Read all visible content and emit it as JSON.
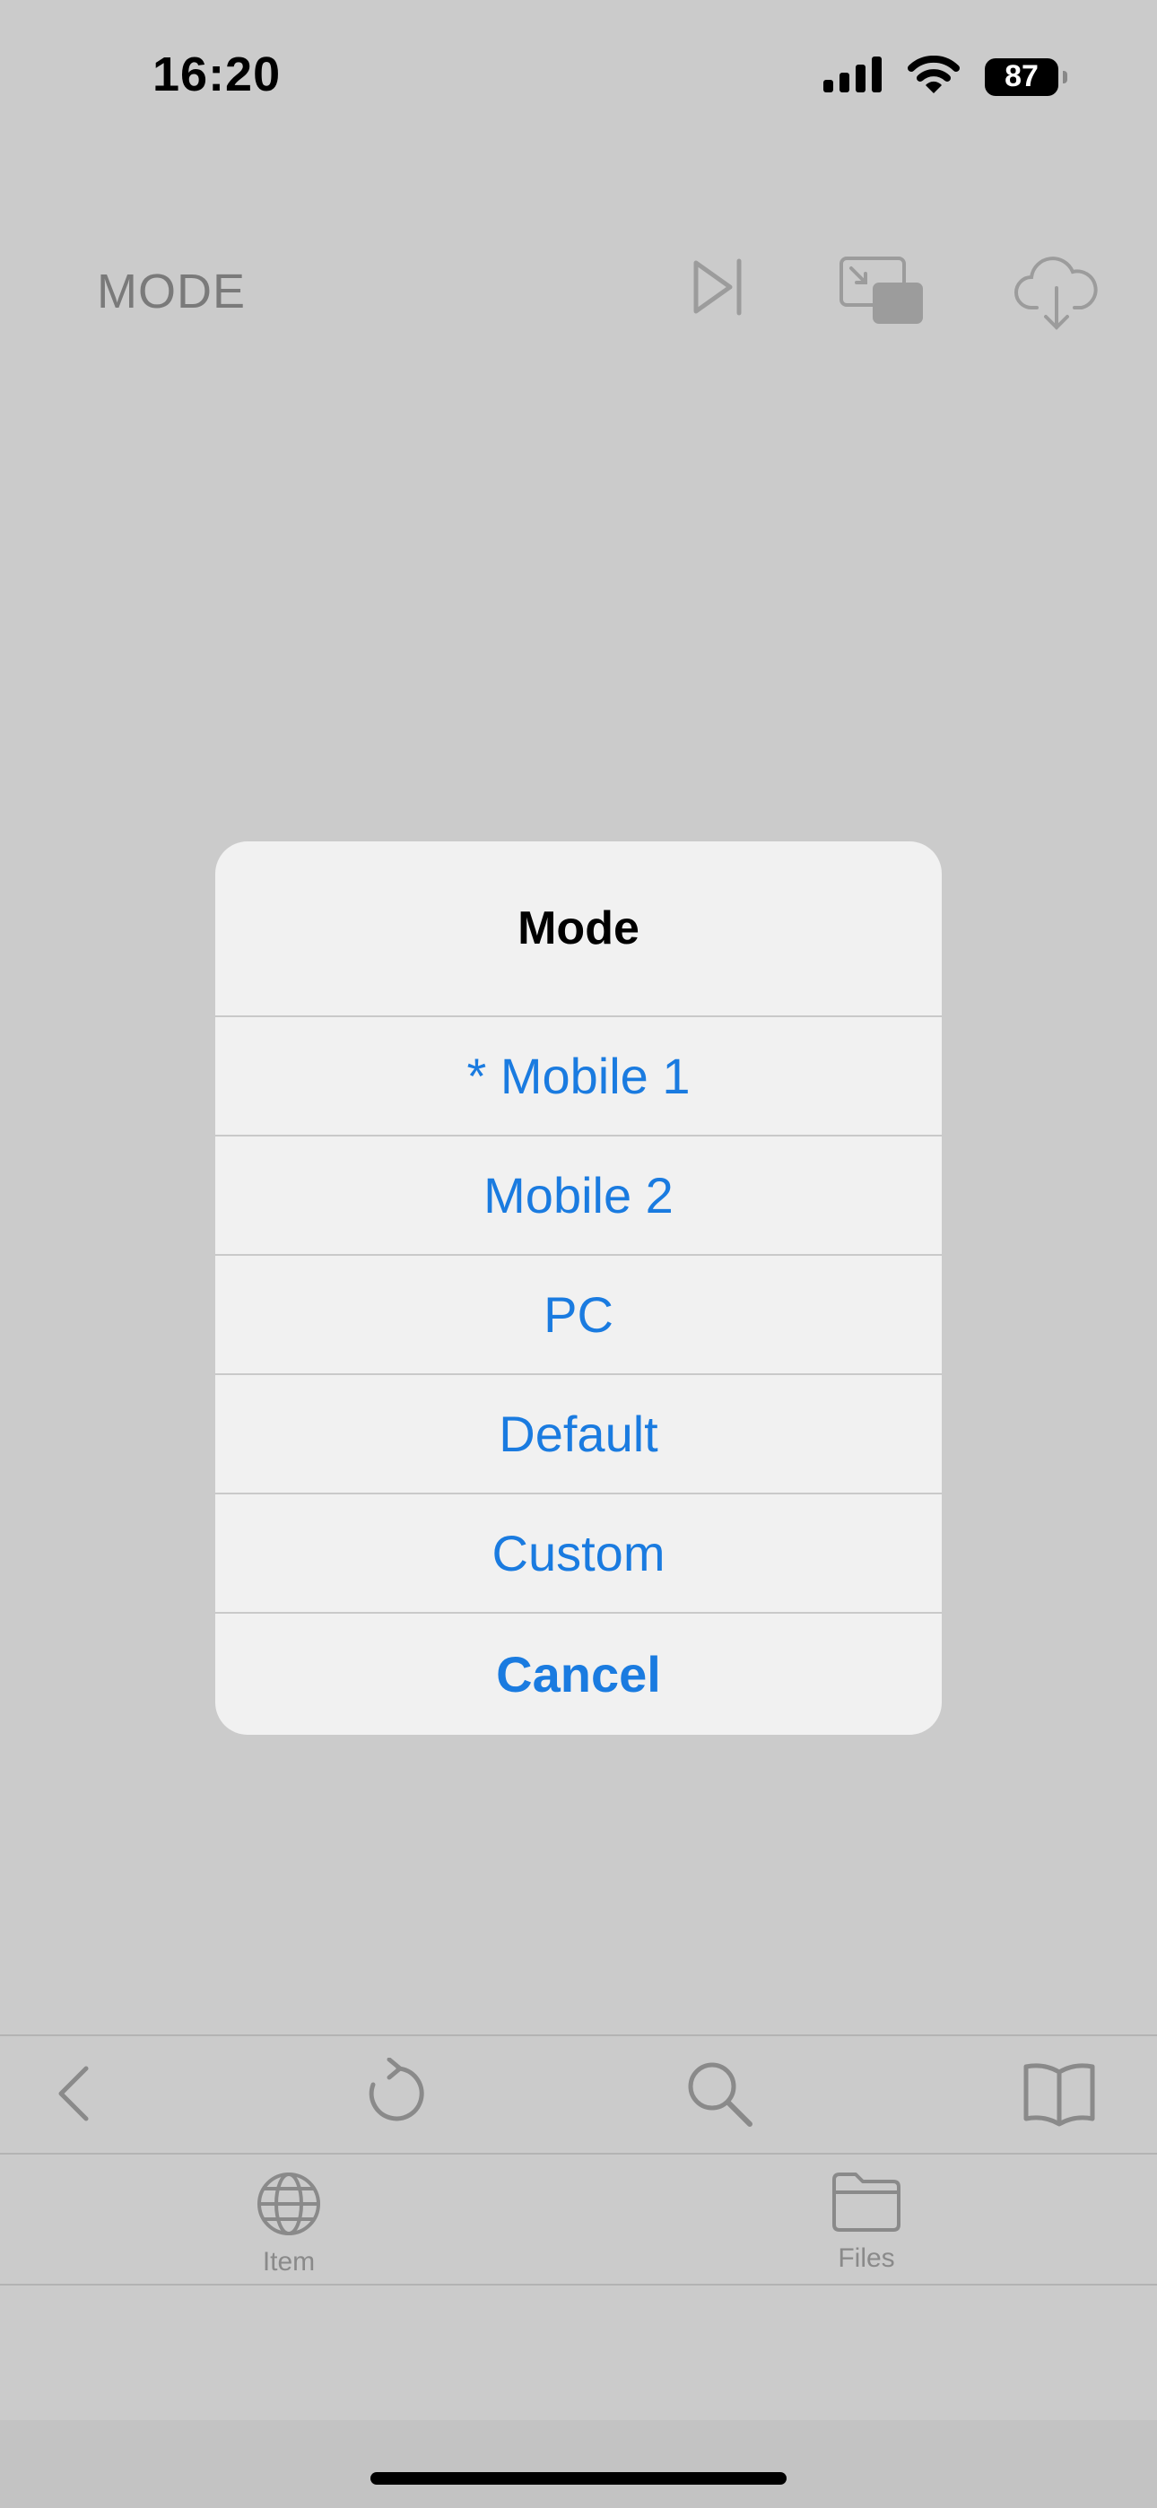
{
  "status_bar": {
    "time": "16:20",
    "battery": "87",
    "icons": [
      "signal-icon",
      "wifi-icon",
      "battery-icon"
    ]
  },
  "top_toolbar": {
    "mode_label": "MODE",
    "icons": [
      "skip-forward-icon",
      "picture-in-picture-icon",
      "cloud-download-icon"
    ]
  },
  "dialog": {
    "title": "Mode",
    "options": [
      "* Mobile 1",
      "Mobile 2",
      "PC",
      "Default",
      "Custom"
    ],
    "cancel": "Cancel",
    "accent_color": "#1a7be0"
  },
  "nav_bar": {
    "icons": [
      "back-chevron-icon",
      "reload-icon",
      "search-icon",
      "bookmarks-book-icon"
    ]
  },
  "tab_bar": {
    "tabs": [
      {
        "label": "Item",
        "icon": "globe-icon"
      },
      {
        "label": "Files",
        "icon": "folder-icon"
      }
    ]
  }
}
